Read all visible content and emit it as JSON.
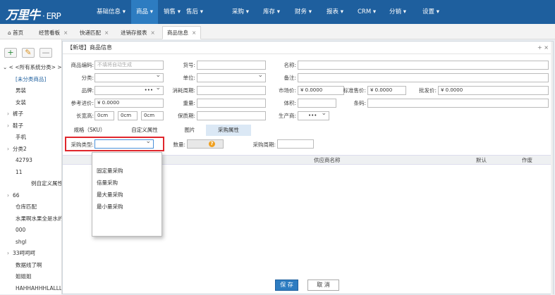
{
  "app": {
    "logo_cn": "万里牛",
    "logo_erp": "· ERP"
  },
  "nav": [
    {
      "label": "基础信息"
    },
    {
      "label": "商品"
    },
    {
      "label": "销售"
    },
    {
      "label": "售后"
    },
    {
      "label": "采购"
    },
    {
      "label": "库存"
    },
    {
      "label": "财务"
    },
    {
      "label": "报表"
    },
    {
      "label": "CRM"
    },
    {
      "label": "分销"
    },
    {
      "label": "设置"
    }
  ],
  "tabs": [
    {
      "label": "首页"
    },
    {
      "label": "经营看板"
    },
    {
      "label": "快递匹配"
    },
    {
      "label": "进销存报表"
    },
    {
      "label": "商品信息"
    }
  ],
  "sidebar": {
    "tools": [
      "+",
      "✎",
      "—"
    ],
    "items": [
      "< <所有系统分类> >",
      "[未分类商品]",
      "男装",
      "女装",
      "裤子",
      "鞋子",
      "手机",
      "分类2",
      "42793",
      "11",
      "例自定义属性",
      "66",
      "仓库匹配",
      "水果啊水果全是水的",
      "000",
      "shgl",
      "33呵呵呵",
      "数据线了啊",
      "姐姐姐",
      "HAHHAHHHLALLL"
    ]
  },
  "dialog": {
    "title": "【新增】商品信息",
    "controls": "+ ×",
    "labels": {
      "code": "商品编码:",
      "huohao": "货号:",
      "name": "名称:",
      "category": "分类:",
      "unit": "单位:",
      "remark": "备注:",
      "brand": "品牌:",
      "cycle": "消耗周期:",
      "mprice": "市场价:",
      "sprice": "标准售价:",
      "wprice": "批发价:",
      "refprice": "参考进价:",
      "weight": "重量:",
      "volume": "体积:",
      "barcode": "条码:",
      "lwh": "长宽高:",
      "shelf": "保质期:",
      "maker": "生产商:"
    },
    "values": {
      "code_ph": "不填将自动生成",
      "brand": "•••",
      "mprice": "¥ 0.0000",
      "sprice": "¥ 0.0000",
      "wprice": "¥ 0.0000",
      "refprice": "¥ 0.0000",
      "len": "0cm",
      "wid": "0cm",
      "hei": "0cm",
      "maker": "•••"
    },
    "subtabs": [
      "规格（SKU）",
      "自定义属性",
      "图片",
      "采购属性"
    ],
    "purchase": {
      "type_label": "采购类型:",
      "qty_label": "数量:",
      "period_label": "采购周期:"
    },
    "table_headers": [
      "供应商名称",
      "默认",
      "作废"
    ],
    "dropdown_options": [
      "固定量采购",
      "倍量采购",
      "最大量采购",
      "最小量采购"
    ],
    "buttons": {
      "save": "保 存",
      "cancel": "取 消"
    }
  }
}
